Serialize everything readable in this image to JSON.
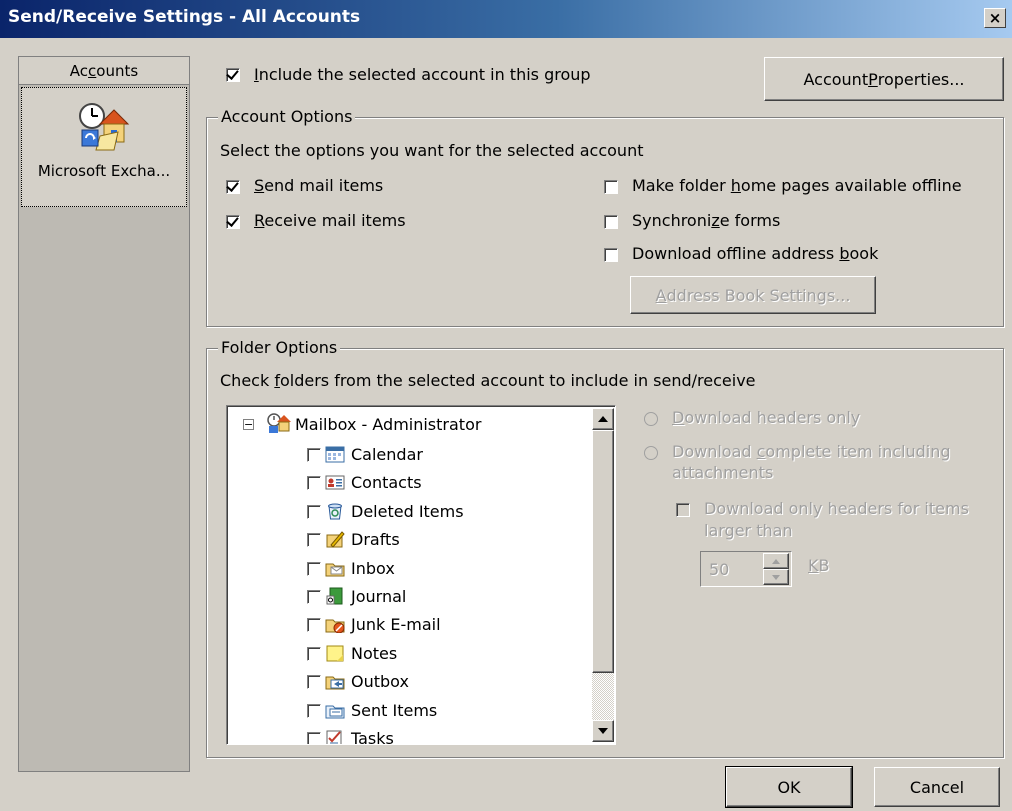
{
  "window": {
    "title": "Send/Receive Settings - All Accounts",
    "close_glyph": "×"
  },
  "accounts": {
    "header_pre": "Ac",
    "header_ul": "c",
    "header_post": "ounts",
    "item_label": "Microsoft Excha..."
  },
  "top": {
    "include_pre": "",
    "include_ul": "I",
    "include_post": "nclude the selected account in this group",
    "include_checked": true,
    "account_props_pre": "Account ",
    "account_props_ul": "P",
    "account_props_post": "roperties..."
  },
  "account_options": {
    "title": "Account Options",
    "description": "Select the options you want for the selected account",
    "send_ul": "S",
    "send_post": "end mail items",
    "send_checked": true,
    "receive_ul": "R",
    "receive_post": "eceive mail items",
    "receive_checked": true,
    "homepages_pre": "Make folder ",
    "homepages_ul": "h",
    "homepages_post": "ome pages available offline",
    "homepages_checked": false,
    "syncforms_pre": "Synchroni",
    "syncforms_ul": "z",
    "syncforms_post": "e forms",
    "syncforms_checked": false,
    "oab_pre": "Download offline address ",
    "oab_ul": "b",
    "oab_post": "ook",
    "oab_checked": false,
    "abs_ul": "A",
    "abs_post": "ddress Book Settings..."
  },
  "folder_options": {
    "title": "Folder Options",
    "desc_pre": "Check ",
    "desc_ul": "f",
    "desc_post": "olders from the selected account to include in send/receive",
    "root": "Mailbox - Administrator",
    "folders": [
      {
        "label": "Calendar",
        "icon": "calendar-icon",
        "checked": false
      },
      {
        "label": "Contacts",
        "icon": "contacts-icon",
        "checked": false
      },
      {
        "label": "Deleted Items",
        "icon": "deleted-items-icon",
        "checked": false
      },
      {
        "label": "Drafts",
        "icon": "drafts-icon",
        "checked": false
      },
      {
        "label": "Inbox",
        "icon": "inbox-icon",
        "checked": false
      },
      {
        "label": "Journal",
        "icon": "journal-icon",
        "checked": false
      },
      {
        "label": "Junk E-mail",
        "icon": "junk-email-icon",
        "checked": false
      },
      {
        "label": "Notes",
        "icon": "notes-icon",
        "checked": false
      },
      {
        "label": "Outbox",
        "icon": "outbox-icon",
        "checked": false
      },
      {
        "label": "Sent Items",
        "icon": "sent-items-icon",
        "checked": false
      },
      {
        "label": "Tasks",
        "icon": "tasks-icon",
        "checked": false
      }
    ],
    "radio_headers_ul": "D",
    "radio_headers_post": "ownload headers only",
    "radio_complete_pre": "Download ",
    "radio_complete_ul": "c",
    "radio_complete_post": "omplete item including",
    "radio_complete_line2": "attachments",
    "headers_larger_pre": "Download only headers for items",
    "headers_larger_line2": "larger than",
    "size_value": "50",
    "size_unit_ul": "K",
    "size_unit_post": "B"
  },
  "footer": {
    "ok_label": "OK",
    "cancel_label": "Cancel"
  },
  "colors": {
    "face": "#d4d0c8",
    "title_start": "#0a246a",
    "title_end": "#a6caf0",
    "disabled_text": "#a0a0a0"
  }
}
